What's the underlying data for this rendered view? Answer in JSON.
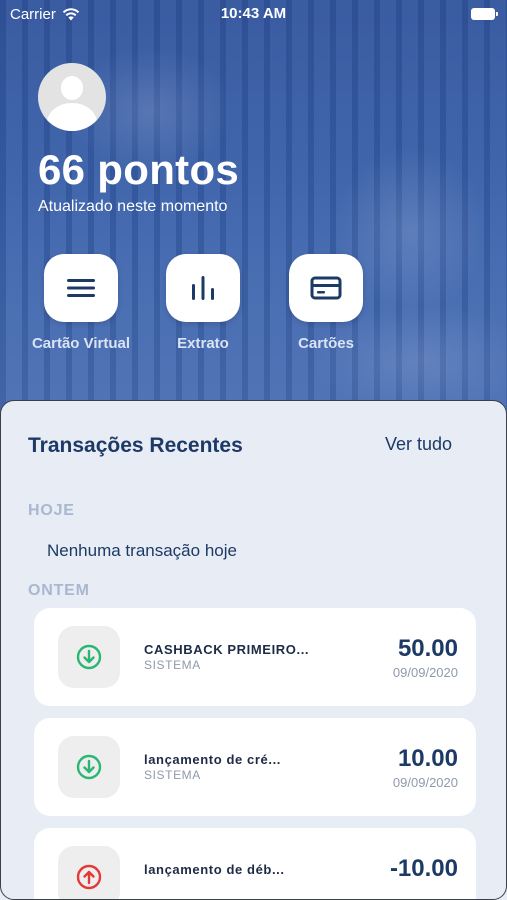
{
  "status_bar": {
    "carrier": "Carrier",
    "time": "10:43 AM"
  },
  "profile": {
    "points": "66 pontos",
    "updated": "Atualizado neste momento"
  },
  "actions": [
    {
      "label": "Cartão Virtual",
      "icon": "menu-icon"
    },
    {
      "label": "Extrato",
      "icon": "bar-chart-icon"
    },
    {
      "label": "Cartões",
      "icon": "credit-card-icon"
    }
  ],
  "transactions": {
    "title": "Transações Recentes",
    "see_all": "Ver tudo",
    "today_label": "HOJE",
    "today_empty": "Nenhuma transação hoje",
    "yesterday_label": "ONTEM",
    "items": [
      {
        "name": "CASHBACK PRIMEIRO...",
        "source": "SISTEMA",
        "amount": "50.00",
        "date": "09/09/2020",
        "icon": "arrow-down-circle-icon",
        "icon_color": "#2bb673"
      },
      {
        "name": "lançamento de cré...",
        "source": "SISTEMA",
        "amount": "10.00",
        "date": "09/09/2020",
        "icon": "arrow-down-circle-icon",
        "icon_color": "#2bb673"
      },
      {
        "name": "lançamento de déb...",
        "source": "",
        "amount": "-10.00",
        "date": "",
        "icon": "arrow-up-circle-icon",
        "icon_color": "#e53935"
      }
    ]
  },
  "colors": {
    "primary": "#1d3a66",
    "credit": "#2bb673",
    "debit": "#e53935"
  }
}
